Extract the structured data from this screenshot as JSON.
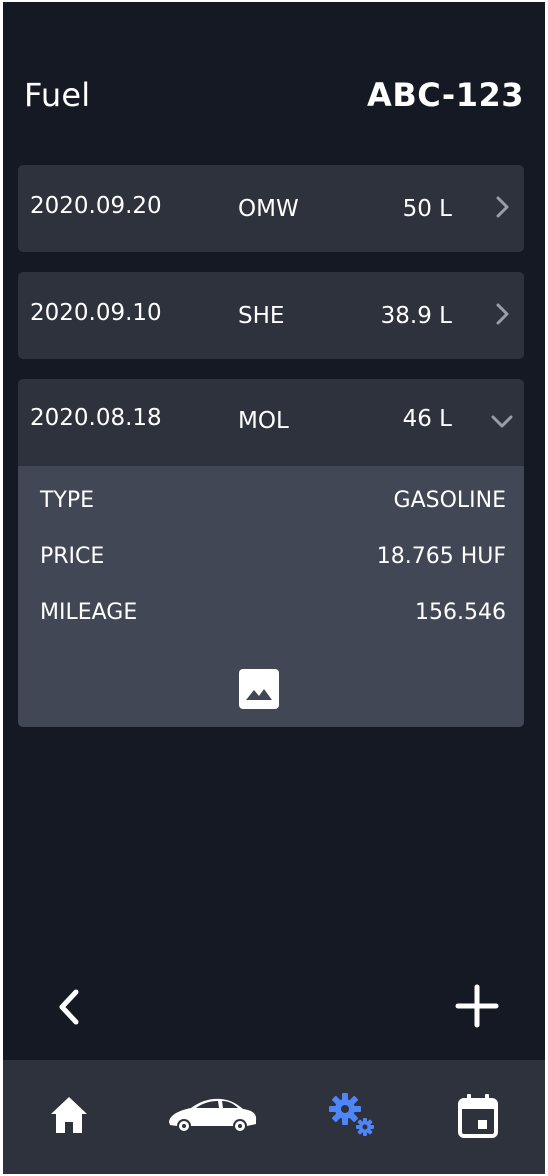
{
  "header": {
    "title": "Fuel",
    "plate": "ABC-123"
  },
  "entries": [
    {
      "date": "2020.09.20",
      "station": "OMW",
      "amount": "50 L",
      "expanded": false,
      "chevron_icon": "chevron-right-icon"
    },
    {
      "date": "2020.09.10",
      "station": "SHE",
      "amount": "38.9 L",
      "expanded": false,
      "chevron_icon": "chevron-right-icon"
    },
    {
      "date": "2020.08.18",
      "station": "MOL",
      "amount": "46 L",
      "expanded": true,
      "chevron_icon": "chevron-down-icon",
      "details": [
        {
          "label": "TYPE",
          "value": "GASOLINE"
        },
        {
          "label": "PRICE",
          "value": "18.765 HUF"
        },
        {
          "label": "MILEAGE",
          "value": "156.546"
        }
      ],
      "attachment_icon": "image-icon"
    }
  ],
  "actions": {
    "back_icon": "chevron-left-icon",
    "add_icon": "plus-icon"
  },
  "bottom_nav": {
    "items": [
      {
        "icon": "home-icon",
        "active": false
      },
      {
        "icon": "car-icon",
        "active": false
      },
      {
        "icon": "gears-icon",
        "active": true
      },
      {
        "icon": "calendar-icon",
        "active": false
      }
    ]
  },
  "colors": {
    "background": "#151923",
    "card": "#2e323d",
    "card_expanded": "#424756",
    "text": "#ffffff",
    "chevron": "#9a9ea8",
    "accent": "#4f86f7",
    "nav_background": "#2e323d"
  }
}
